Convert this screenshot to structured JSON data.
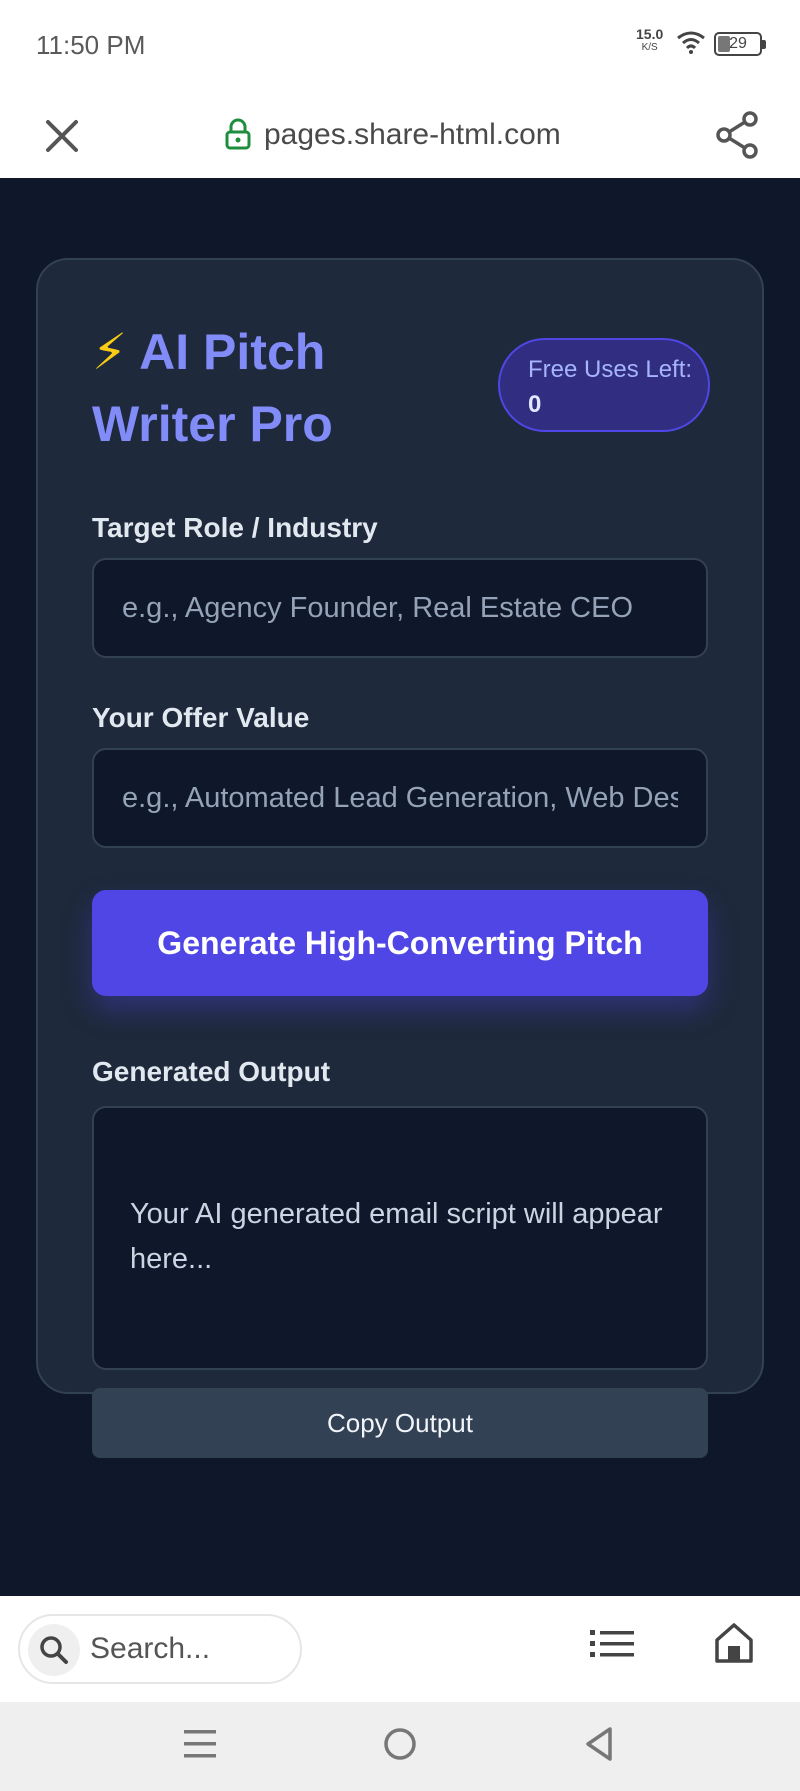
{
  "status_bar": {
    "time": "11:50 PM",
    "net_rate_value": "15.0",
    "net_rate_unit": "K/S",
    "battery": "29"
  },
  "browser": {
    "url": "pages.share-html.com",
    "close_icon": "close-icon",
    "lock_icon": "lock-icon",
    "share_icon": "share-icon"
  },
  "app": {
    "title_emoji": "⚡",
    "title": "AI Pitch Writer Pro",
    "badge_label": "Free Uses Left:",
    "badge_count": "0",
    "role_label": "Target Role / Industry",
    "role_placeholder": "e.g., Agency Founder, Real Estate CEO",
    "offer_label": "Your Offer Value",
    "offer_placeholder": "e.g., Automated Lead Generation, Web Design",
    "generate_button": "Generate High-Converting Pitch",
    "output_label": "Generated Output",
    "output_placeholder": "Your AI generated email script will appear here...",
    "copy_button": "Copy Output"
  },
  "bottom_bar": {
    "search_placeholder": "Search...",
    "list_icon": "list-icon",
    "home_icon": "home-icon"
  },
  "colors": {
    "page_bg": "#0f172a",
    "card_bg": "#1e293b",
    "accent": "#4f46e5",
    "title": "#818cf8"
  }
}
